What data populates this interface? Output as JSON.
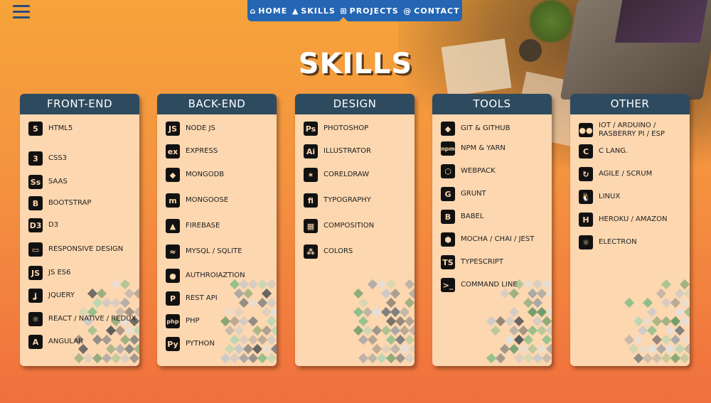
{
  "nav": {
    "items": [
      {
        "icon": "home-icon",
        "glyph": "⌂",
        "label": "HOME"
      },
      {
        "icon": "graduation-cap-icon",
        "glyph": "▲",
        "label": "SKILLS"
      },
      {
        "icon": "sitemap-icon",
        "glyph": "⊞",
        "label": "PROJECTS"
      },
      {
        "icon": "at-icon",
        "glyph": "@",
        "label": "CONTACT"
      }
    ]
  },
  "title": "SKILLS",
  "cards": [
    {
      "title": "FRONT-END",
      "items": [
        {
          "icon": "html5-icon",
          "glyph": "5",
          "label": "HTML5"
        },
        {
          "icon": "css3-icon",
          "glyph": "3",
          "label": "CSS3"
        },
        {
          "icon": "sass-icon",
          "glyph": "Ss",
          "label": "SAAS"
        },
        {
          "icon": "bootstrap-icon",
          "glyph": "B",
          "label": "BOOTSTRAP"
        },
        {
          "icon": "d3-icon",
          "glyph": "D3",
          "label": "D3"
        },
        {
          "icon": "responsive-design-icon",
          "glyph": "▭",
          "label": "RESPONSIVE DESIGN"
        },
        {
          "icon": "js-icon",
          "glyph": "JS",
          "label": "JS ES6"
        },
        {
          "icon": "jquery-icon",
          "glyph": "ʝ",
          "label": "JQUERY"
        },
        {
          "icon": "react-icon",
          "glyph": "⚛",
          "label": "REACT / NATIVE / REDUX"
        },
        {
          "icon": "angular-icon",
          "glyph": "A",
          "label": "ANGULAR"
        }
      ]
    },
    {
      "title": "BACK-END",
      "items": [
        {
          "icon": "nodejs-icon",
          "glyph": "JS",
          "label": "NODE JS"
        },
        {
          "icon": "express-icon",
          "glyph": "ex",
          "label": "EXPRESS"
        },
        {
          "icon": "mongodb-icon",
          "glyph": "◆",
          "label": "MONGODB"
        },
        {
          "icon": "mongoose-icon",
          "glyph": "m",
          "label": "MONGOOSE"
        },
        {
          "icon": "firebase-icon",
          "glyph": "▲",
          "label": "FIREBASE"
        },
        {
          "icon": "mysql-icon",
          "glyph": "≈",
          "label": "MYSQL / SQLITE"
        },
        {
          "icon": "authorization-icon",
          "glyph": "●",
          "label": "AUTHROIAZTION"
        },
        {
          "icon": "rest-api-icon",
          "glyph": "P",
          "label": "REST API"
        },
        {
          "icon": "php-icon",
          "glyph": "php",
          "label": "PHP"
        },
        {
          "icon": "python-icon",
          "glyph": "Py",
          "label": "PYTHON"
        }
      ]
    },
    {
      "title": "DESIGN",
      "items": [
        {
          "icon": "photoshop-icon",
          "glyph": "Ps",
          "label": "PHOTOSHOP"
        },
        {
          "icon": "illustrator-icon",
          "glyph": "Ai",
          "label": "ILLUSTRATOR"
        },
        {
          "icon": "coreldraw-icon",
          "glyph": "✶",
          "label": "CORELDRAW"
        },
        {
          "icon": "typography-icon",
          "glyph": "fi",
          "label": "TYPOGRAPHY"
        },
        {
          "icon": "composition-icon",
          "glyph": "▦",
          "label": "COMPOSITION"
        },
        {
          "icon": "colors-icon",
          "glyph": "⁂",
          "label": "COLORS"
        }
      ]
    },
    {
      "title": "TOOLS",
      "items": [
        {
          "icon": "git-icon",
          "glyph": "◆",
          "label": "GIT & GITHUB"
        },
        {
          "icon": "npm-icon",
          "glyph": "npm",
          "label": "NPM & YARN"
        },
        {
          "icon": "webpack-icon",
          "glyph": "⬡",
          "label": "WEBPACK"
        },
        {
          "icon": "grunt-icon",
          "glyph": "G",
          "label": "GRUNT"
        },
        {
          "icon": "babel-icon",
          "glyph": "B",
          "label": "BABEL"
        },
        {
          "icon": "mocha-icon",
          "glyph": "⬢",
          "label": "MOCHA / CHAI / JEST"
        },
        {
          "icon": "typescript-icon",
          "glyph": "TS",
          "label": "TYPESCRIPT"
        },
        {
          "icon": "command-line-icon",
          "glyph": ">_",
          "label": "COMMAND LINE"
        }
      ]
    },
    {
      "title": "OTHER",
      "items": [
        {
          "icon": "iot-icon",
          "glyph": "●●",
          "label": "IOT / ARDUINO / RASBERRY PI / ESP"
        },
        {
          "icon": "c-lang-icon",
          "glyph": "C",
          "label": "C LANG."
        },
        {
          "icon": "agile-icon",
          "glyph": "↻",
          "label": "AGILE / SCRUM"
        },
        {
          "icon": "linux-icon",
          "glyph": "🐧",
          "label": "LINUX"
        },
        {
          "icon": "heroku-icon",
          "glyph": "H",
          "label": "HEROKU / AMAZON"
        },
        {
          "icon": "electron-icon",
          "glyph": "⚛",
          "label": "ELECTRON"
        }
      ]
    }
  ],
  "colors": {
    "nav_bg": "#2466b3",
    "card_head": "#2e4a5e",
    "card_body": "#fcd7b0",
    "accent_orange": "#f49240"
  }
}
